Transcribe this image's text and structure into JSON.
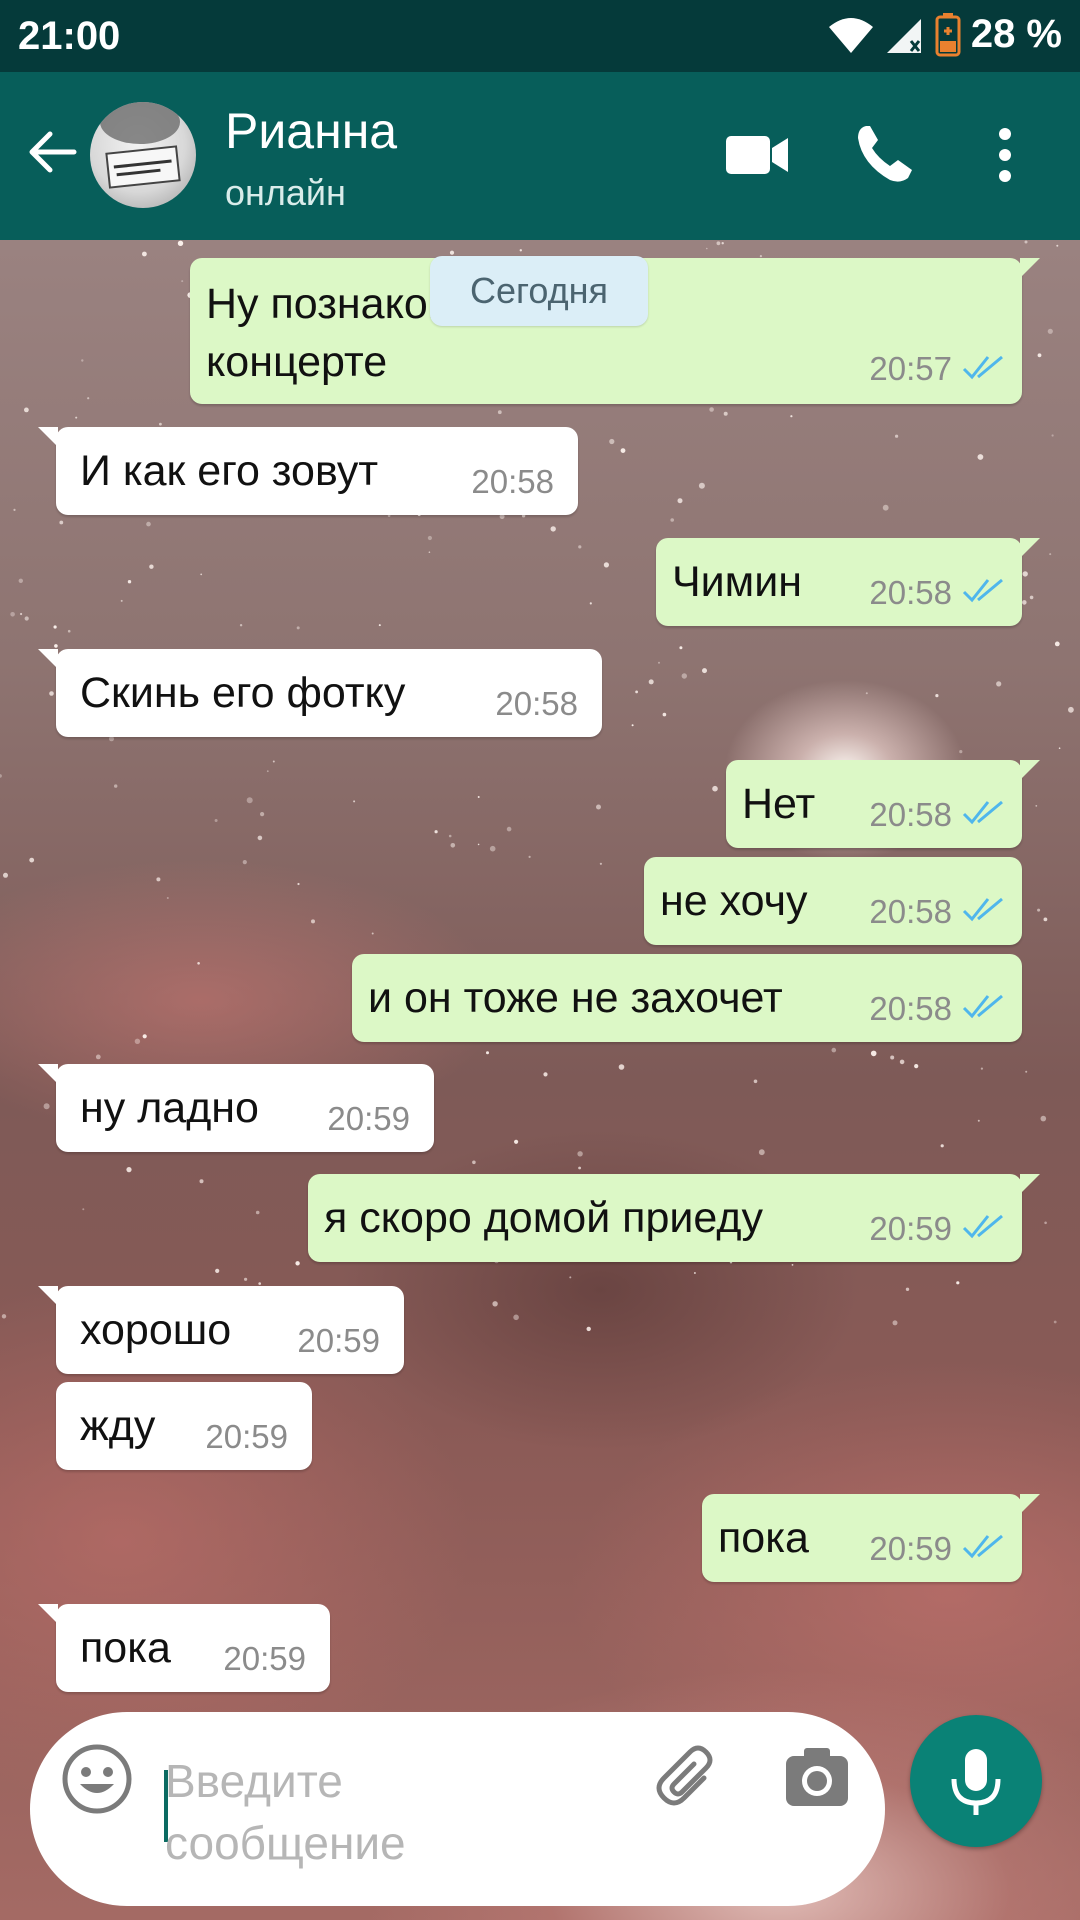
{
  "status_bar": {
    "time": "21:00",
    "battery": "28 %"
  },
  "header": {
    "contact_name": "Рианна",
    "contact_status": "онлайн"
  },
  "chat": {
    "date_chip": "Сегодня",
    "messages": [
      {
        "dir": "out",
        "text_line1": "Ну познакомились на",
        "text_line2": "концерте",
        "time": "20:57"
      },
      {
        "dir": "in",
        "text": "И как его зовут",
        "time": "20:58"
      },
      {
        "dir": "out",
        "text": "Чимин",
        "time": "20:58"
      },
      {
        "dir": "in",
        "text": "Скинь его фотку",
        "time": "20:58"
      },
      {
        "dir": "out",
        "text": "Нет",
        "time": "20:58"
      },
      {
        "dir": "out",
        "text": "не хочу",
        "time": "20:58"
      },
      {
        "dir": "out",
        "text": "и он тоже не захочет",
        "time": "20:58"
      },
      {
        "dir": "in",
        "text": "ну ладно",
        "time": "20:59"
      },
      {
        "dir": "out",
        "text": "я скоро домой приеду",
        "time": "20:59"
      },
      {
        "dir": "in",
        "text": "хорошо",
        "time": "20:59"
      },
      {
        "dir": "in",
        "text": "жду",
        "time": "20:59"
      },
      {
        "dir": "out",
        "text": "пока",
        "time": "20:59"
      },
      {
        "dir": "in",
        "text": "пока",
        "time": "20:59"
      }
    ]
  },
  "composer": {
    "placeholder": "Введите сообщение"
  },
  "colors": {
    "appbar": "#075e5a",
    "status_bar": "#053a3a",
    "outgoing": "#dcf8c6",
    "incoming": "#ffffff",
    "ticks": "#4fb6ec",
    "mic": "#0a8276"
  },
  "icons": [
    "back-arrow-icon",
    "video-call-icon",
    "phone-icon",
    "more-vert-icon",
    "emoji-icon",
    "attach-icon",
    "camera-icon",
    "mic-icon",
    "wifi-icon",
    "signal-icon",
    "battery-icon",
    "double-check-icon"
  ]
}
